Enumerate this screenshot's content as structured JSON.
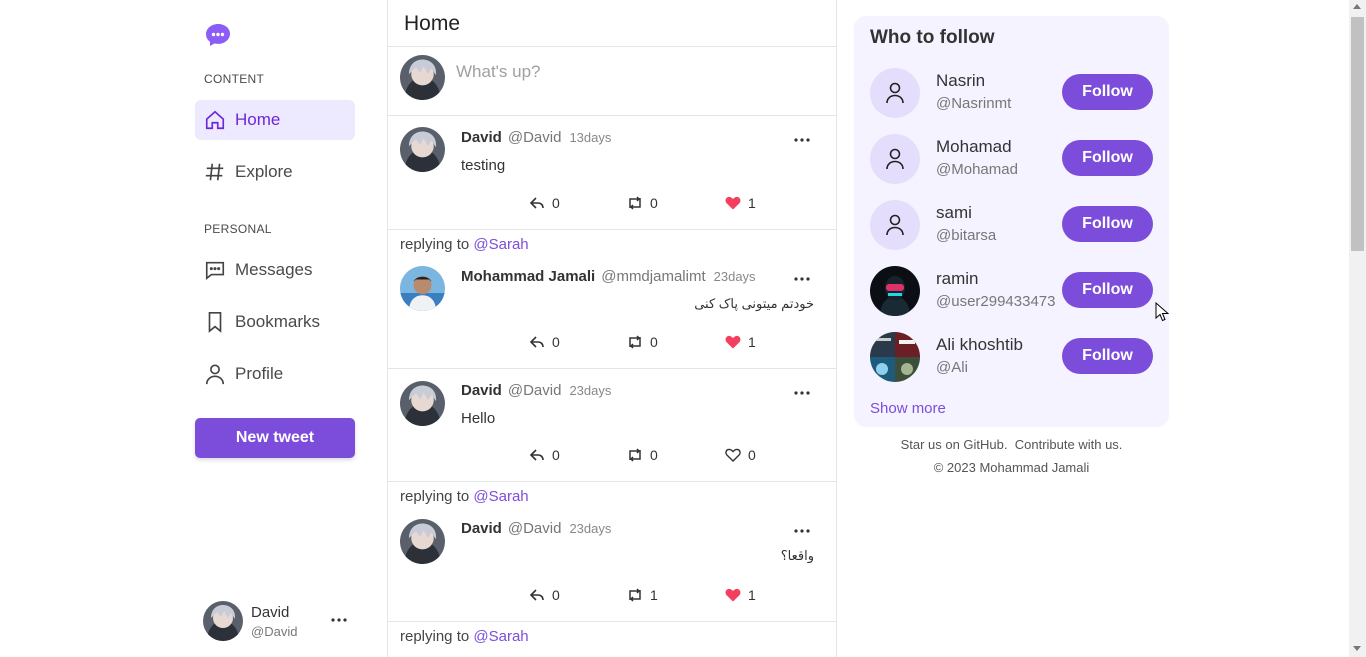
{
  "colors": {
    "accent": "#7c4ddb",
    "active_bg": "#ede9fe",
    "heart": "#f43f5e"
  },
  "sidebar": {
    "content_label": "CONTENT",
    "personal_label": "PERSONAL",
    "items": [
      {
        "label": "Home",
        "icon": "home-icon",
        "active": true
      },
      {
        "label": "Explore",
        "icon": "hash-icon"
      },
      {
        "label": "Messages",
        "icon": "message-icon"
      },
      {
        "label": "Bookmarks",
        "icon": "bookmark-icon"
      },
      {
        "label": "Profile",
        "icon": "user-icon"
      }
    ],
    "new_tweet_label": "New tweet",
    "user": {
      "name": "David",
      "handle": "@David"
    }
  },
  "feed": {
    "title": "Home",
    "compose_placeholder": "What's up?",
    "tweets": [
      {
        "name": "David",
        "handle": "@David",
        "time": "13days",
        "text": "testing",
        "replies": "0",
        "retweets": "0",
        "likes": "1",
        "liked": true
      },
      {
        "replying_prefix": "replying to",
        "replying_to": "@Sarah",
        "name": "Mohammad Jamali",
        "handle": "@mmdjamalimt",
        "time": "23days",
        "text": "خودتم میتونی پاک کنی",
        "replies": "0",
        "retweets": "0",
        "likes": "1",
        "liked": true
      },
      {
        "name": "David",
        "handle": "@David",
        "time": "23days",
        "text": "Hello",
        "replies": "0",
        "retweets": "0",
        "likes": "0",
        "liked": false
      },
      {
        "replying_prefix": "replying to",
        "replying_to": "@Sarah",
        "name": "David",
        "handle": "@David",
        "time": "23days",
        "text": "واقعا؟",
        "replies": "0",
        "retweets": "1",
        "likes": "1",
        "liked": true
      },
      {
        "replying_prefix": "replying to",
        "replying_to": "@Sarah"
      }
    ]
  },
  "who_to_follow": {
    "title": "Who to follow",
    "users": [
      {
        "name": "Nasrin",
        "handle": "@Nasrinmt",
        "button": "Follow"
      },
      {
        "name": "Mohamad",
        "handle": "@Mohamad",
        "button": "Follow"
      },
      {
        "name": "sami",
        "handle": "@bitarsa",
        "button": "Follow"
      },
      {
        "name": "ramin",
        "handle": "@user299433473",
        "button": "Follow"
      },
      {
        "name": "Ali khoshtib",
        "handle": "@Ali",
        "button": "Follow"
      }
    ],
    "show_more": "Show more"
  },
  "footer": {
    "star": "Star us on GitHub.",
    "contribute": "Contribute with us.",
    "copyright": "© 2023 Mohammad Jamali"
  }
}
